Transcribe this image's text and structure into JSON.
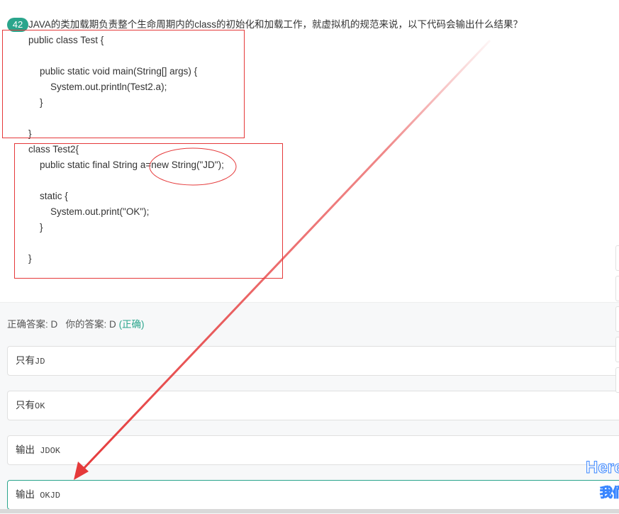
{
  "question": {
    "number": "42",
    "title": "JAVA的类加载期负责整个生命周期内的class的初始化和加载工作，就虚拟机的规范来说，以下代码会输出什么结果？",
    "code_lines": [
      "public class Test {",
      "public static void main(String[] args) {",
      "System.out.println(Test2.a);",
      "}",
      "}",
      "class Test2{",
      "public static final String a=new String(\"JD\");",
      "static {",
      "System.out.print(\"OK\");",
      "}",
      "}"
    ]
  },
  "answer": {
    "correct_label": "正确答案: D",
    "yours_label": "你的答案: D",
    "status": "(正确)"
  },
  "options": [
    {
      "prefix": "只有",
      "code": "JD"
    },
    {
      "prefix": "只有",
      "code": "OK"
    },
    {
      "prefix": "输出",
      "code": " JDOK"
    },
    {
      "prefix": "输出",
      "code": " OKJD"
    }
  ],
  "watermark": {
    "line1": "Here",
    "line2": "我们"
  },
  "colors": {
    "accent": "#2aa58c",
    "annotation": "#e5393a",
    "watermark": "#3a86ff"
  }
}
